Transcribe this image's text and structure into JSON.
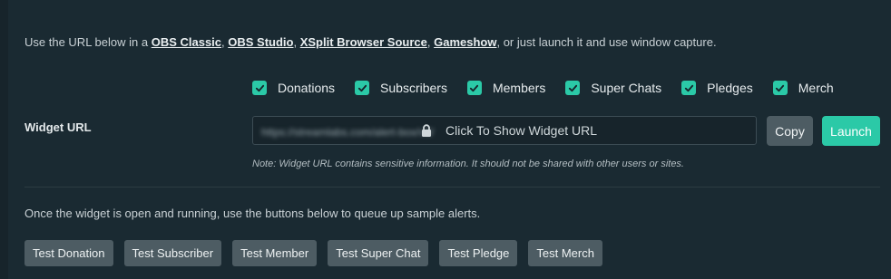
{
  "intro": {
    "prefix": "Use the URL below in a ",
    "links": [
      "OBS Classic",
      "OBS Studio",
      "XSplit Browser Source",
      "Gameshow"
    ],
    "sep": ", ",
    "suffix": ", or just launch it and use window capture."
  },
  "alert_types": [
    {
      "label": "Donations",
      "checked": true
    },
    {
      "label": "Subscribers",
      "checked": true
    },
    {
      "label": "Members",
      "checked": true
    },
    {
      "label": "Super Chats",
      "checked": true
    },
    {
      "label": "Pledges",
      "checked": true
    },
    {
      "label": "Merch",
      "checked": true
    }
  ],
  "widget": {
    "label": "Widget URL",
    "blurred_url": "https://streamlabs.com/alert-box/v3/",
    "reveal_text": "Click To Show Widget URL",
    "copy_label": "Copy",
    "launch_label": "Launch",
    "note": "Note: Widget URL contains sensitive information. It should not be shared with other users or sites."
  },
  "queue_text": "Once the widget is open and running, use the buttons below to queue up sample alerts.",
  "test_buttons": [
    "Test Donation",
    "Test Subscriber",
    "Test Member",
    "Test Super Chat",
    "Test Pledge",
    "Test Merch"
  ],
  "colors": {
    "accent": "#2bc9a7",
    "panel": "#1a2a32",
    "button": "#4d5c63"
  },
  "icons": {
    "checkbox": "checkmark-icon",
    "lock": "lock-icon"
  }
}
